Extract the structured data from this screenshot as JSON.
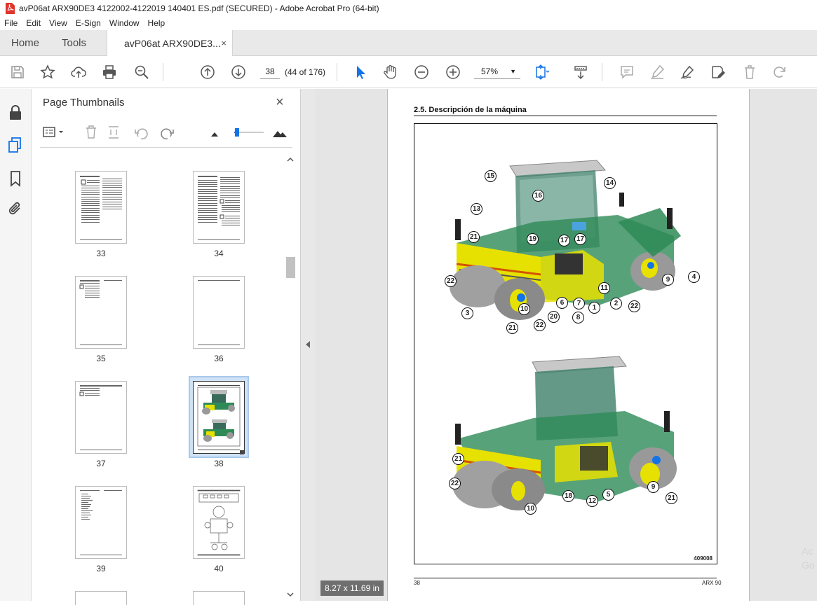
{
  "window": {
    "title": "avP06at ARX90DE3 4122002-4122019 140401 ES.pdf (SECURED) - Adobe Acrobat Pro (64-bit)",
    "icon": "acrobat-pdf-icon"
  },
  "menu": [
    "File",
    "Edit",
    "View",
    "E-Sign",
    "Window",
    "Help"
  ],
  "tabs": {
    "home": "Home",
    "tools": "Tools",
    "doc": "avP06at ARX90DE3...",
    "doc_close": "×"
  },
  "toolbar": {
    "page_number": "38",
    "page_count": "(44 of 176)",
    "zoom": "57%"
  },
  "panel": {
    "title": "Page Thumbnails",
    "close": "×",
    "thumbnails": [
      {
        "label": "33"
      },
      {
        "label": "34"
      },
      {
        "label": "35"
      },
      {
        "label": "36"
      },
      {
        "label": "37"
      },
      {
        "label": "38",
        "selected": true
      },
      {
        "label": "39"
      },
      {
        "label": "40"
      }
    ]
  },
  "document": {
    "section_title": "2.5.    Descripción de la máquina",
    "figure_id": "409008",
    "footer_left": "38",
    "footer_right": "ARX 90",
    "page_size": "8.27 x 11.69 in",
    "callouts_top": [
      "15",
      "16",
      "14",
      "13",
      "21",
      "19",
      "17",
      "17",
      "4",
      "22",
      "9",
      "11",
      "6",
      "7",
      "10",
      "1",
      "2",
      "22",
      "3",
      "20",
      "8",
      "22",
      "21"
    ],
    "callouts_bottom": [
      "21",
      "22",
      "18",
      "12",
      "5",
      "9",
      "21",
      "10"
    ]
  },
  "colors": {
    "accent_blue": "#1473e6",
    "machine_green": "#2e8b57",
    "machine_yellow": "#e6e100"
  },
  "watermark": {
    "line1": "Ac",
    "line2": "Go"
  }
}
